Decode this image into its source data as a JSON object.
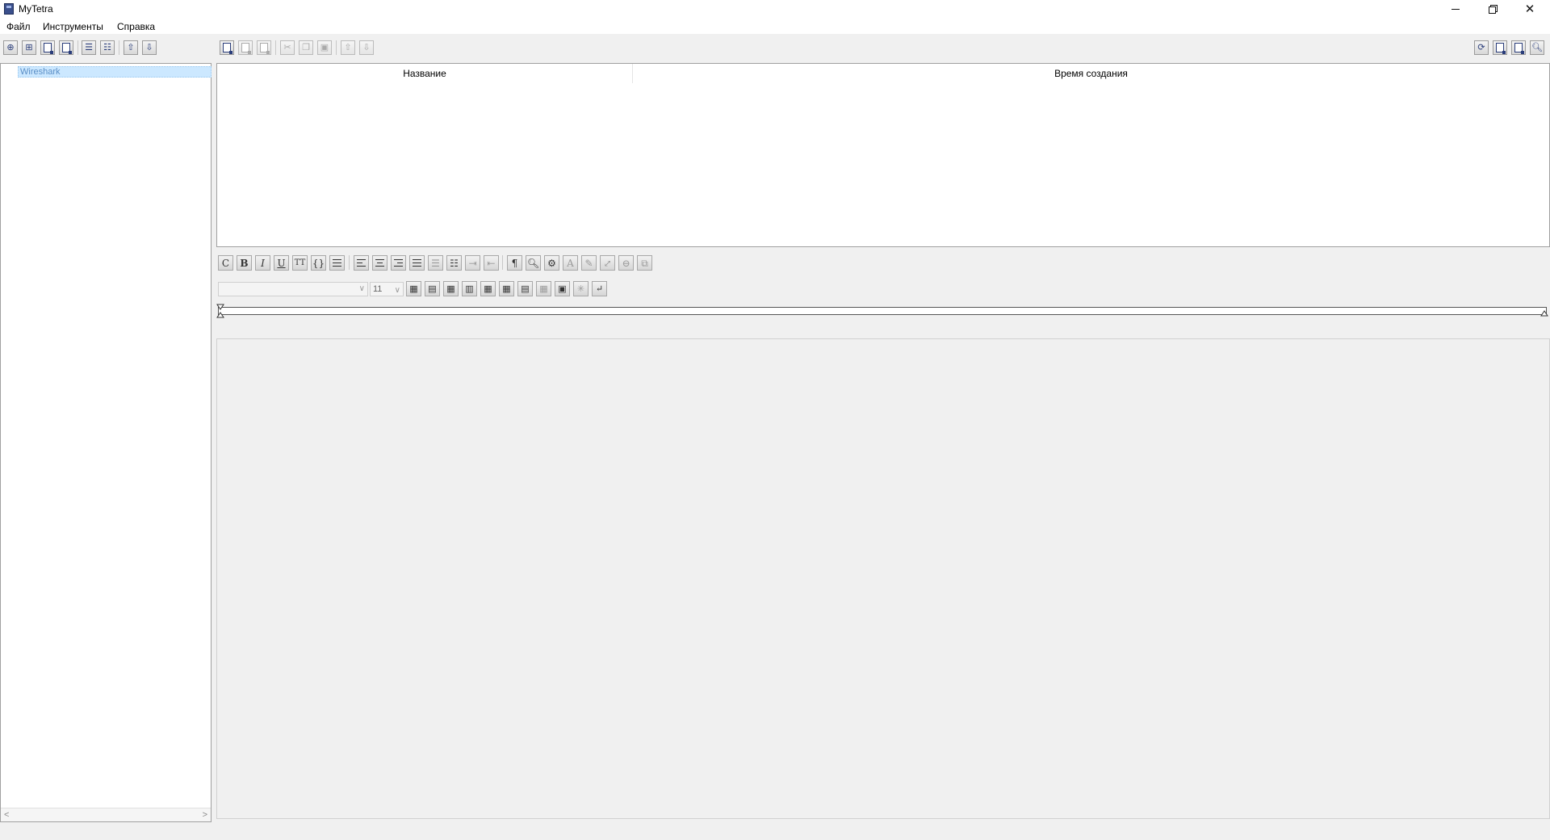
{
  "window": {
    "title": "MyTetra",
    "controls": {
      "minimize": "minimize-icon",
      "maximize": "restore-icon",
      "close": "close-icon"
    }
  },
  "menu": [
    "Файл",
    "Инструменты",
    "Справка"
  ],
  "tree_toolbar": {
    "buttons": [
      "add-branch-icon",
      "add-subbranch-icon",
      "edit-branch-icon",
      "delete-branch-icon",
      "expand-all-icon",
      "collapse-all-icon",
      "move-up-icon",
      "move-down-icon"
    ]
  },
  "record_toolbar": {
    "buttons": [
      "add-record-icon",
      "add-record-context-icon",
      "edit-record-icon",
      "cut-icon",
      "copy-icon",
      "paste-icon",
      "move-record-up-icon",
      "move-record-down-icon"
    ]
  },
  "right_toolbar": {
    "buttons": [
      "sync-icon",
      "find-in-base-icon",
      "export-icon",
      "search-icon"
    ]
  },
  "tree": {
    "items": [
      {
        "label": "Wireshark",
        "selected": true
      }
    ]
  },
  "record_table": {
    "columns": [
      "Название",
      "Время создания"
    ],
    "rows": []
  },
  "format_toolbar": {
    "clear_label": "C",
    "bold_label": "B",
    "italic_label": "I",
    "underline_label": "U",
    "monospace_label": "TT",
    "code_label": "{}",
    "font_size_value": "11",
    "font_family_value": ""
  },
  "colors": {
    "selection_bg": "#cce8ff",
    "selection_text": "#5a8ec6",
    "app_bg": "#f0f0f0"
  }
}
